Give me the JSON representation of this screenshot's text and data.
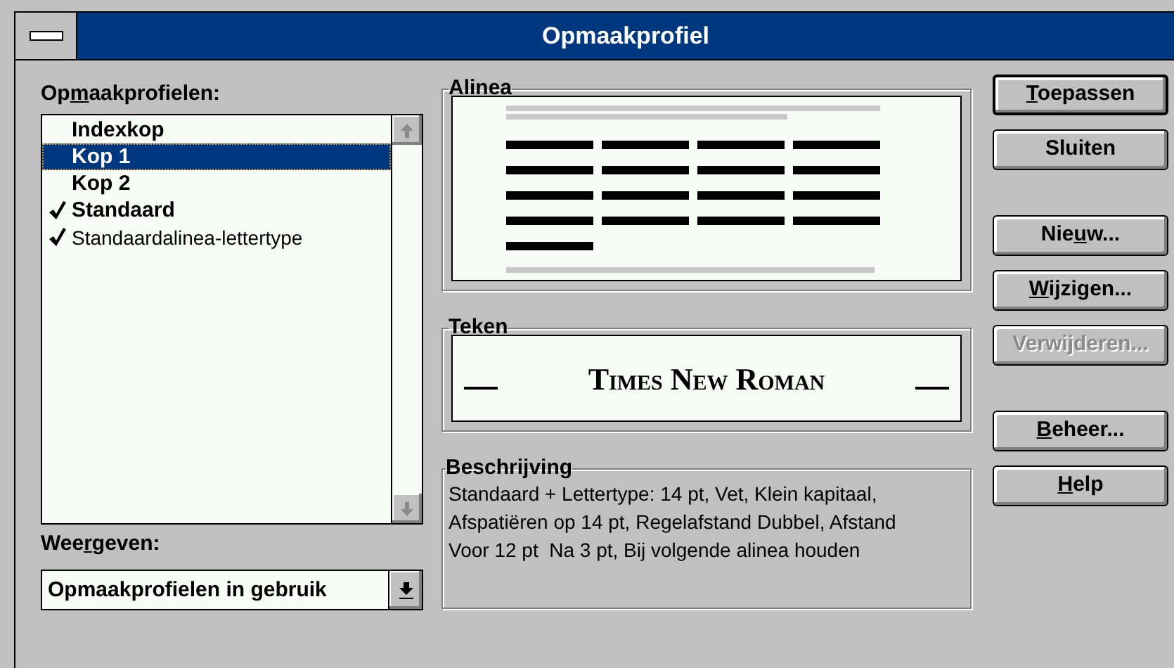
{
  "window": {
    "title": "Opmaakprofiel"
  },
  "styles_list": {
    "label": {
      "label_before": "Op",
      "access_key": "m",
      "label_after": "aakprofielen:"
    },
    "items": [
      {
        "name": "Indexkop",
        "kind": "paragraph",
        "in_use": false,
        "selected": false
      },
      {
        "name": "Kop 1",
        "kind": "paragraph",
        "in_use": false,
        "selected": true
      },
      {
        "name": "Kop 2",
        "kind": "paragraph",
        "in_use": false,
        "selected": false
      },
      {
        "name": "Standaard",
        "kind": "paragraph",
        "in_use": true,
        "selected": false
      },
      {
        "name": "Standaardalinea-lettertype",
        "kind": "character",
        "in_use": true,
        "selected": false
      }
    ]
  },
  "show": {
    "label": {
      "label_before": "Wee",
      "access_key": "r",
      "label_after": "geven:"
    },
    "value": "Opmaakprofielen in gebruik"
  },
  "paragraph_preview": {
    "title": "Alinea"
  },
  "character_preview": {
    "title": "Teken",
    "sample": "Times New Roman"
  },
  "description": {
    "title": "Beschrijving",
    "text": "Standaard + Lettertype: 14 pt, Vet, Klein kapitaal, Afspatiëren op 14 pt, Regelafstand Dubbel, Afstand Voor 12 pt  Na 3 pt, Bij volgende alinea houden"
  },
  "button_groups": [
    [
      {
        "access_key": "T",
        "label_after": "oepassen",
        "default": true,
        "disabled": false
      },
      {
        "label": "Sluiten",
        "default": false,
        "disabled": false
      }
    ],
    [
      {
        "label_before": "Nie",
        "access_key": "u",
        "label_after": "w...",
        "default": false,
        "disabled": false
      },
      {
        "access_key": "W",
        "label_after": "ijzigen...",
        "default": false,
        "disabled": false
      },
      {
        "label": "Verwijderen...",
        "default": false,
        "disabled": true
      }
    ],
    [
      {
        "access_key": "B",
        "label_after": "eheer...",
        "default": false,
        "disabled": false
      },
      {
        "access_key": "H",
        "label_after": "elp",
        "default": false,
        "disabled": false
      }
    ]
  ]
}
